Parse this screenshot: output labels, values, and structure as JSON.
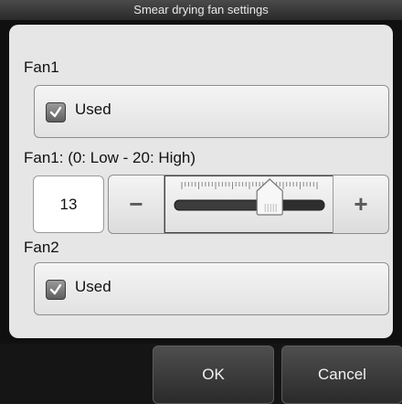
{
  "dialog": {
    "title": "Smear drying fan settings"
  },
  "fan1": {
    "section_label": "Fan1",
    "checkbox_label": "Used",
    "checked": true
  },
  "fan1_level": {
    "label": "Fan1: (0: Low - 20: High)",
    "value": "13",
    "min": 0,
    "max": 20,
    "minus_symbol": "−",
    "plus_symbol": "+"
  },
  "fan2": {
    "section_label": "Fan2",
    "checkbox_label": "Used",
    "checked": true
  },
  "buttons": {
    "ok_label": "OK",
    "cancel_label": "Cancel"
  },
  "icons": {
    "check": "checkmark-icon",
    "minus": "minus-icon",
    "plus": "plus-icon",
    "slider_thumb": "slider-thumb-icon"
  }
}
